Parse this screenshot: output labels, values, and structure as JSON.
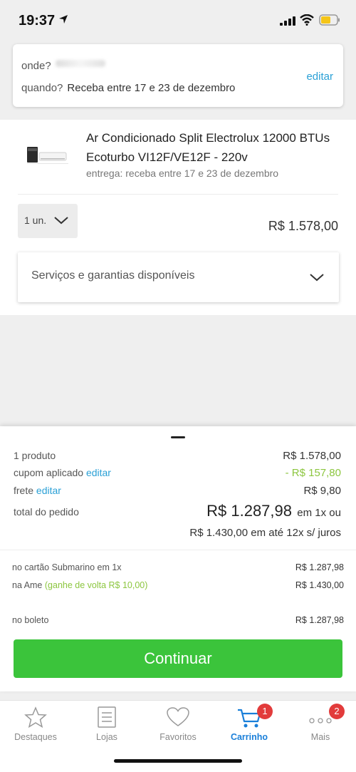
{
  "status": {
    "time": "19:37"
  },
  "delivery": {
    "where_label": "onde?",
    "when_label": "quando?",
    "when_value": "Receba entre 17 e 23 de dezembro",
    "edit_label": "editar"
  },
  "product": {
    "title": "Ar Condicionado Split Electrolux 12000 BTUs Ecoturbo VI12F/VE12F - 220v",
    "delivery_text": "entrega: receba entre 17 e 23 de dezembro",
    "qty_label": "1 un.",
    "price": "R$ 1.578,00",
    "services_label": "Serviços e garantias disponíveis"
  },
  "summary": {
    "products_label": "1 produto",
    "products_value": "R$ 1.578,00",
    "coupon_label": "cupom aplicado",
    "coupon_edit": "editar",
    "coupon_value": "- R$ 157,80",
    "shipping_label": "frete",
    "shipping_edit": "editar",
    "shipping_value": "R$ 9,80",
    "total_label": "total do pedido",
    "total_value": "R$ 1.287,98",
    "total_suffix": "em 1x ou",
    "installments": "R$ 1.430,00 em até 12x s/ juros"
  },
  "payment": {
    "card_label": "no cartão Submarino em 1x",
    "card_value": "R$ 1.287,98",
    "ame_label": "na Ame",
    "ame_cashback": "(ganhe de volta R$ 10,00)",
    "ame_value": "R$ 1.430,00",
    "boleto_label": "no boleto",
    "boleto_value": "R$ 1.287,98"
  },
  "continue_label": "Continuar",
  "tabs": [
    {
      "label": "Destaques",
      "icon": "star-icon"
    },
    {
      "label": "Lojas",
      "icon": "list-icon"
    },
    {
      "label": "Favoritos",
      "icon": "heart-icon"
    },
    {
      "label": "Carrinho",
      "icon": "cart-icon",
      "active": true,
      "badge": "1"
    },
    {
      "label": "Mais",
      "icon": "more-icon",
      "badge": "2"
    }
  ],
  "colors": {
    "accent": "#2aa0d6",
    "cta": "#3bc43b",
    "active_tab": "#1a7fd9",
    "discount": "#8cc63f",
    "badge": "#e23b3b"
  }
}
